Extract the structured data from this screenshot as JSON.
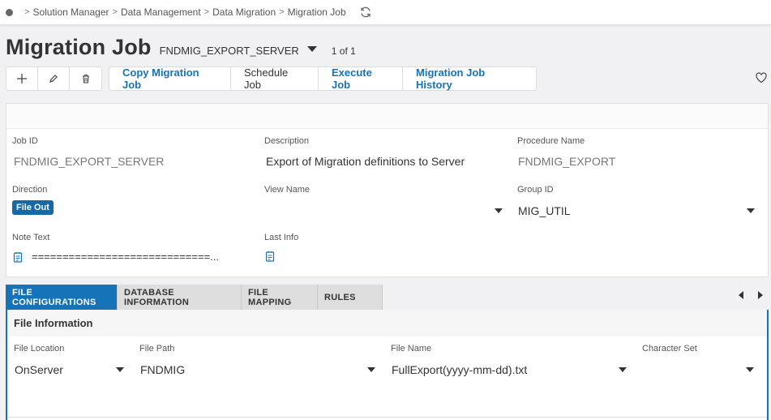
{
  "breadcrumb": {
    "items": [
      "Solution Manager",
      "Data Management",
      "Data Migration",
      "Migration Job"
    ]
  },
  "header": {
    "title": "Migration Job",
    "record": "FNDMIG_EXPORT_SERVER",
    "record_count": "1 of 1"
  },
  "toolbar": {
    "icons": [
      "add-icon",
      "edit-icon",
      "delete-icon"
    ],
    "buttons": [
      "Copy Migration Job",
      "Schedule Job",
      "Execute Job",
      "Migration Job History"
    ]
  },
  "form": {
    "job_id_label": "Job ID",
    "job_id": "FNDMIG_EXPORT_SERVER",
    "description_label": "Description",
    "description": "Export of Migration definitions to Server",
    "procedure_label": "Procedure Name",
    "procedure": "FNDMIG_EXPORT",
    "direction_label": "Direction",
    "direction": "File Out",
    "view_name_label": "View Name",
    "view_name": "",
    "group_id_label": "Group ID",
    "group_id": "MIG_UTIL",
    "note_text_label": "Note Text",
    "note_text": "=============================...",
    "last_info_label": "Last Info"
  },
  "tabs": [
    "FILE CONFIGURATIONS",
    "DATABASE INFORMATION",
    "FILE MAPPING",
    "RULES"
  ],
  "file_info": {
    "title": "File Information",
    "location_label": "File Location",
    "location": "OnServer",
    "path_label": "File Path",
    "path": "FNDMIG",
    "name_label": "File Name",
    "name": "FullExport(yyyy-mm-dd).txt",
    "charset_label": "Character Set",
    "charset": ""
  },
  "colors": {
    "accent": "#1773b8",
    "badge": "#1769a6"
  }
}
